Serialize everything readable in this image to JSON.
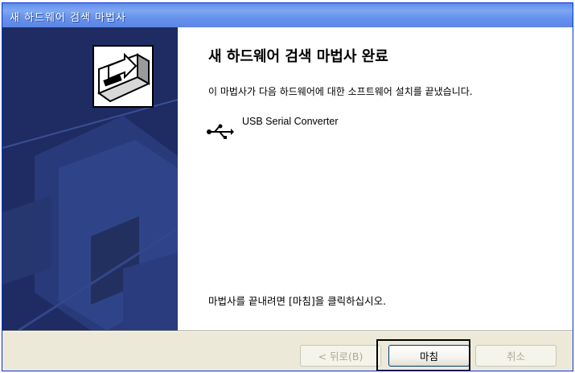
{
  "window": {
    "title": "새 하드웨어 검색 마법사"
  },
  "main": {
    "heading": "새 하드웨어 검색 마법사 완료",
    "message": "이 마법사가 다음 하드웨어에 대한 소프트웨어 설치를 끝냈습니다.",
    "device": {
      "icon": "usb-icon",
      "name": "USB Serial Converter"
    },
    "finish_hint": "마법사를 끝내려면 [마침]을 클릭하십시오."
  },
  "buttons": {
    "back_label": "< 뒤로(B)",
    "finish_label": "마침",
    "cancel_label": "취소"
  },
  "colors": {
    "title_bar": "#5b86e3",
    "side_panel": "#1f2c63",
    "button_face": "#ece9d8"
  }
}
